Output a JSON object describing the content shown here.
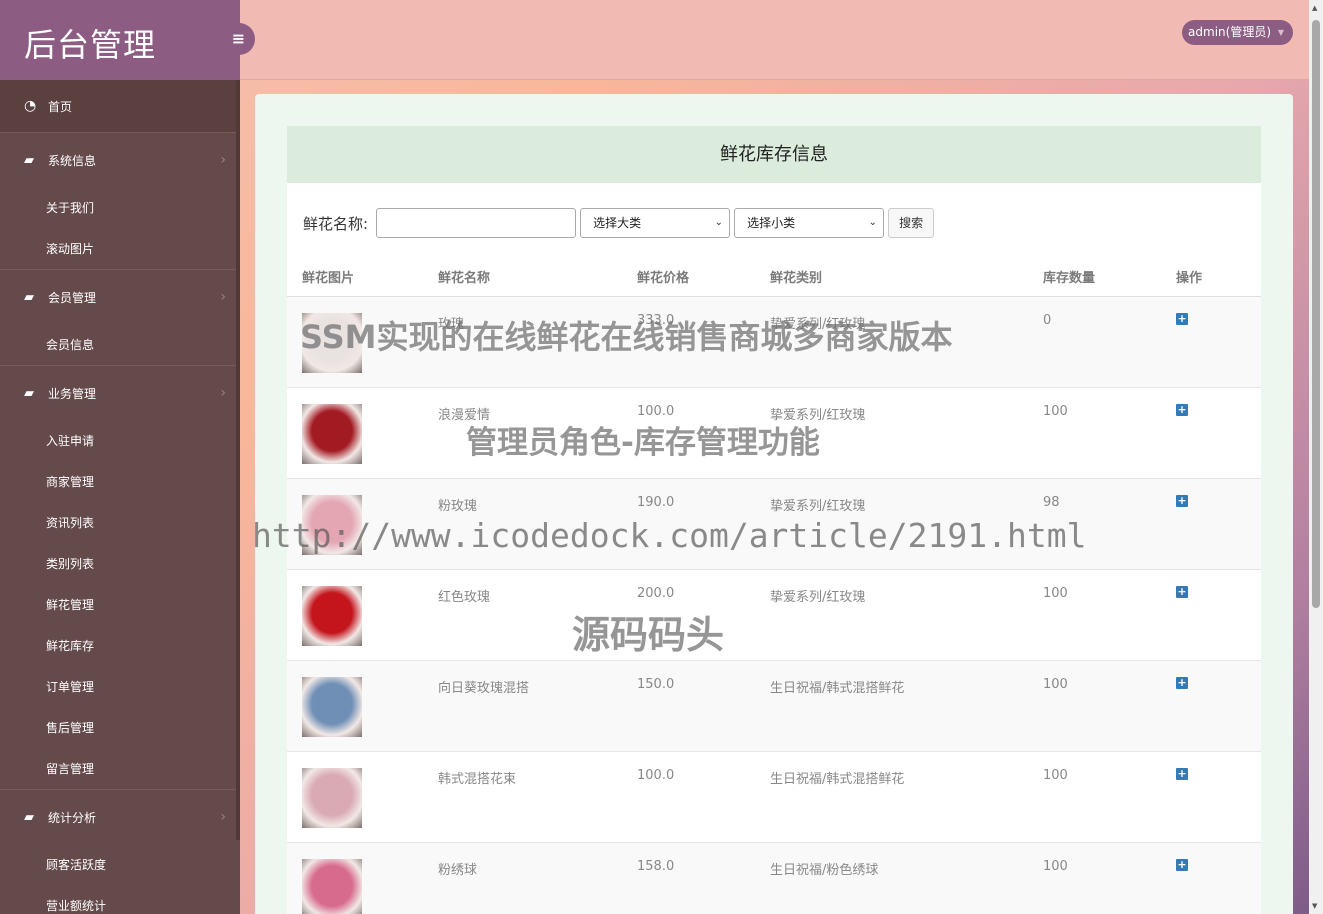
{
  "brand": "后台管理",
  "toggle_icon": "≡",
  "admin_label": "admin(管理员)",
  "nav": {
    "home": "首页",
    "groups": [
      {
        "title": "系统信息",
        "items": [
          "关于我们",
          "滚动图片"
        ]
      },
      {
        "title": "会员管理",
        "items": [
          "会员信息"
        ]
      },
      {
        "title": "业务管理",
        "items": [
          "入驻申请",
          "商家管理",
          "资讯列表",
          "类别列表",
          "鲜花管理",
          "鲜花库存",
          "订单管理",
          "售后管理",
          "留言管理"
        ]
      },
      {
        "title": "统计分析",
        "items": [
          "顾客活跃度",
          "营业额统计"
        ]
      }
    ]
  },
  "page": {
    "title": "鲜花库存信息",
    "search_label": "鲜花名称:",
    "search_value": "",
    "select_category": "选择大类",
    "select_subcategory": "选择小类",
    "search_button": "搜索"
  },
  "table": {
    "headers": [
      "鲜花图片",
      "鲜花名称",
      "鲜花价格",
      "鲜花类别",
      "库存数量",
      "操作"
    ],
    "rows": [
      {
        "name": "玫瑰",
        "price": "333.0",
        "category": "挚爱系列/红玫瑰",
        "stock": "0",
        "img_color": "#e8e2e0"
      },
      {
        "name": "浪漫爱情",
        "price": "100.0",
        "category": "挚爱系列/红玫瑰",
        "stock": "100",
        "img_color": "#a31b22"
      },
      {
        "name": "粉玫瑰",
        "price": "190.0",
        "category": "挚爱系列/红玫瑰",
        "stock": "98",
        "img_color": "#e3a6b2"
      },
      {
        "name": "红色玫瑰",
        "price": "200.0",
        "category": "挚爱系列/红玫瑰",
        "stock": "100",
        "img_color": "#c4141c"
      },
      {
        "name": "向日葵玫瑰混搭",
        "price": "150.0",
        "category": "生日祝福/韩式混搭鲜花",
        "stock": "100",
        "img_color": "#6f8fb6"
      },
      {
        "name": "韩式混搭花束",
        "price": "100.0",
        "category": "生日祝福/韩式混搭鲜花",
        "stock": "100",
        "img_color": "#d9a9b4"
      },
      {
        "name": "粉绣球",
        "price": "158.0",
        "category": "生日祝福/粉色绣球",
        "stock": "100",
        "img_color": "#d76b8e"
      }
    ]
  },
  "watermark": {
    "line1": "SSM实现的在线鲜花在线销售商城多商家版本",
    "line2": "管理员角色-库存管理功能",
    "line3": "http://www.icodedock.com/article/2191.html",
    "line4": "源码码头"
  },
  "colors": {
    "sidebar": "#654a4b",
    "brand": "#8c5c82",
    "accent_icon": "#337ab7"
  }
}
